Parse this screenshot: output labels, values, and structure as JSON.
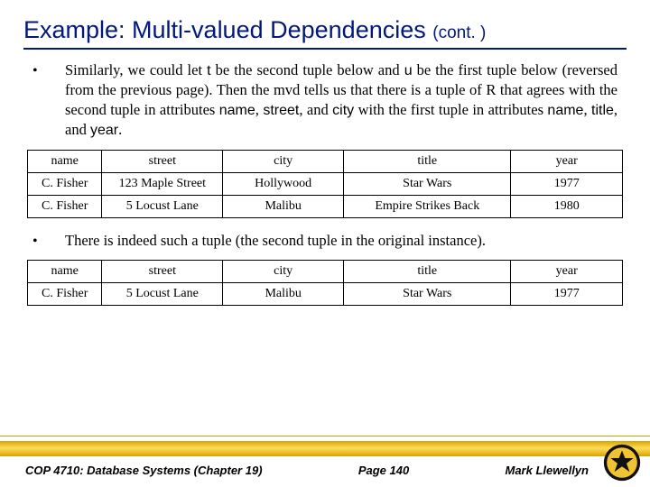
{
  "title_main": "Example: Multi-valued Dependencies ",
  "title_cont": "(cont. )",
  "bullet1_pre": "Similarly, we could let ",
  "bullet1_t": "t",
  "bullet1_mid1": " be the second tuple below and ",
  "bullet1_u": "u",
  "bullet1_mid2": " be the first tuple below (reversed from the previous page).  Then the mvd tells us that there is a tuple of R that agrees with the second tuple in attributes ",
  "bullet1_name": "name",
  "bullet1_c1": ", ",
  "bullet1_street": "street",
  "bullet1_c2": ", and ",
  "bullet1_city": "city",
  "bullet1_mid3": " with the first tuple in attributes ",
  "bullet1_name2": "name",
  "bullet1_c3": ", ",
  "bullet1_title": "title",
  "bullet1_c4": ", and ",
  "bullet1_year": "year",
  "bullet1_end": ".",
  "bullet2": "There is indeed such a tuple (the second tuple in the original instance).",
  "headers": {
    "name": "name",
    "street": "street",
    "city": "city",
    "title": "title",
    "year": "year"
  },
  "table1": [
    {
      "name": "C. Fisher",
      "street": "123 Maple Street",
      "city": "Hollywood",
      "title": "Star Wars",
      "year": "1977"
    },
    {
      "name": "C. Fisher",
      "street": "5 Locust Lane",
      "city": "Malibu",
      "title": "Empire Strikes Back",
      "year": "1980"
    }
  ],
  "table2": [
    {
      "name": "C. Fisher",
      "street": "5 Locust Lane",
      "city": "Malibu",
      "title": "Star Wars",
      "year": "1977"
    }
  ],
  "footer": {
    "course": "COP 4710: Database Systems  (Chapter 19)",
    "page": "Page 140",
    "author": "Mark Llewellyn"
  }
}
